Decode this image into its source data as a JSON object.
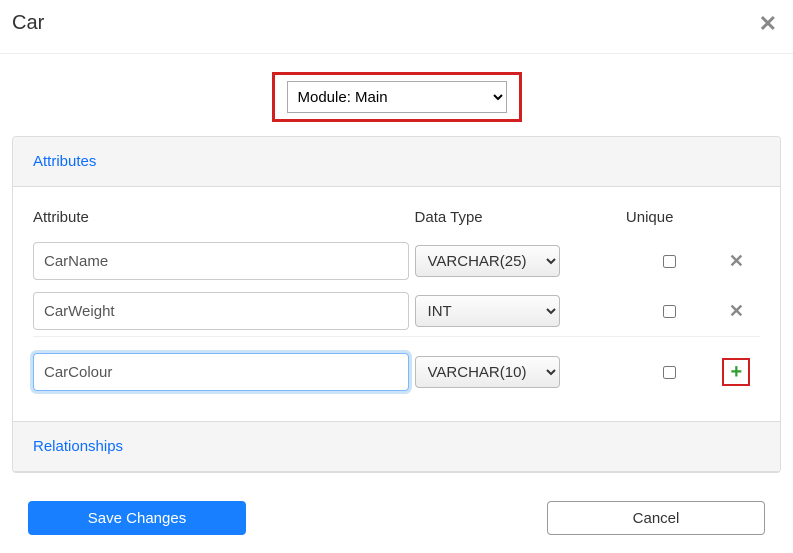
{
  "header": {
    "title": "Car"
  },
  "module": {
    "label": "Module: Main"
  },
  "sections": {
    "attributes": "Attributes",
    "relationships": "Relationships"
  },
  "columns": {
    "attribute": "Attribute",
    "dataType": "Data Type",
    "unique": "Unique"
  },
  "rows": [
    {
      "name": "CarName",
      "type": "VARCHAR(25)",
      "unique": false
    },
    {
      "name": "CarWeight",
      "type": "INT",
      "unique": false
    }
  ],
  "newRow": {
    "name": "CarColour",
    "type": "VARCHAR(10)",
    "unique": false
  },
  "buttons": {
    "save": "Save Changes",
    "cancel": "Cancel"
  }
}
